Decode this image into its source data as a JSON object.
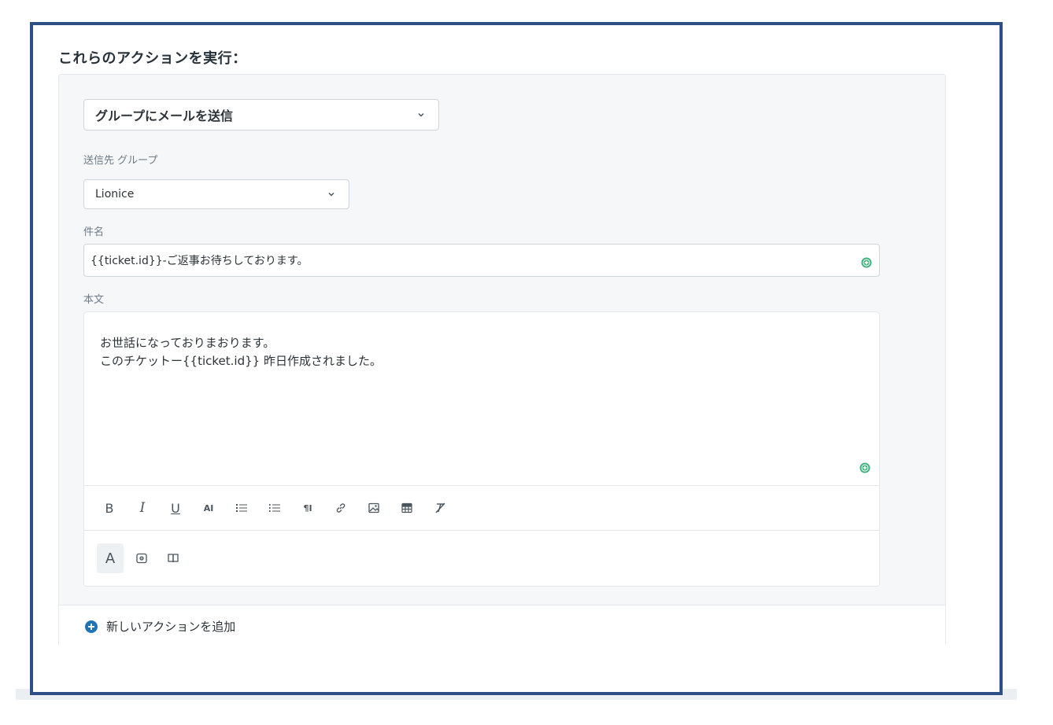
{
  "heading": "これらのアクションを実行：",
  "action": {
    "selected": "グループにメールを送信"
  },
  "group": {
    "label": "送信先 グループ",
    "selected": "Lionice"
  },
  "subject": {
    "label": "件名",
    "value": "{{ticket.id}}-ご返事お待ちしております。"
  },
  "body": {
    "label": "本文",
    "line1": "お世話になっておりまおります。",
    "line2": "このチケットー{{ticket.id}} 昨日作成されました。"
  },
  "toolbar": {
    "bold": "B",
    "italic": "I",
    "underline": "U",
    "font_size": "AI",
    "paragraph": "¶I"
  },
  "toolbar2": {
    "text_mode": "A"
  },
  "add_action": {
    "label": "新しいアクションを追加"
  },
  "colors": {
    "frame": "#2d4f86",
    "accent_blue": "#1f73b7",
    "insert_green": "#3bb07a"
  },
  "icons": [
    "chevron-down-icon",
    "plus-circle-green-icon",
    "bullet-list-icon",
    "numbered-list-icon",
    "link-icon",
    "image-icon",
    "table-icon",
    "clear-format-icon",
    "placeholder-icon",
    "book-icon",
    "plus-circle-blue-icon"
  ]
}
